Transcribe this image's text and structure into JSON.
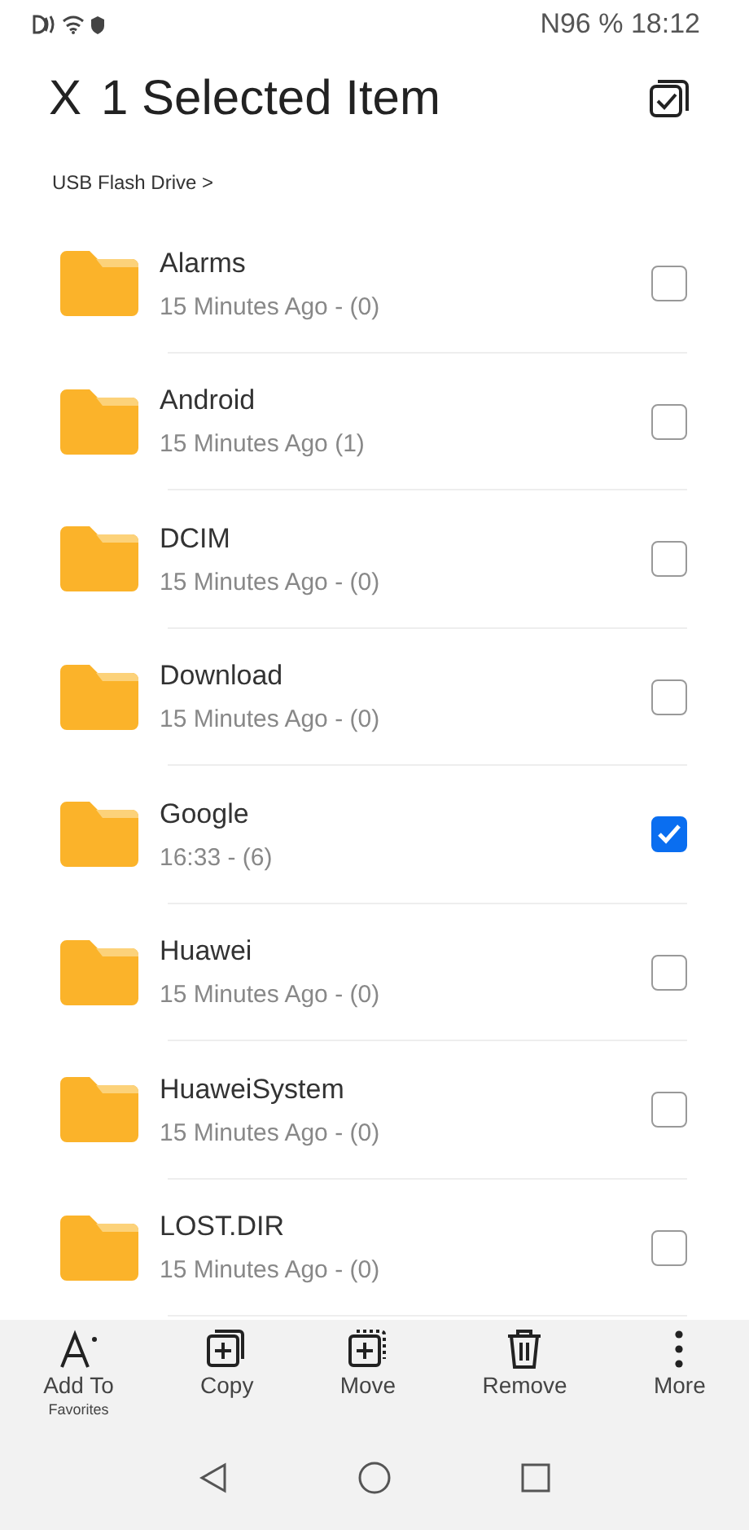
{
  "status_bar": {
    "time": "N96 % 18:12"
  },
  "header": {
    "close": "X",
    "title": "1 Selected Item"
  },
  "breadcrumb": "USB Flash Drive >",
  "folders": [
    {
      "name": "Alarms",
      "info": "15 Minutes Ago - (0)",
      "selected": false
    },
    {
      "name": "Android",
      "info": "15 Minutes Ago (1)",
      "selected": false
    },
    {
      "name": "DCIM",
      "info": "15 Minutes Ago - (0)",
      "selected": false
    },
    {
      "name": "Download",
      "info": "15 Minutes Ago - (0)",
      "selected": false
    },
    {
      "name": "Google",
      "info": "16:33 - (6)",
      "selected": true
    },
    {
      "name": "Huawei",
      "info": "15 Minutes Ago - (0)",
      "selected": false
    },
    {
      "name": "HuaweiSystem",
      "info": "15 Minutes Ago - (0)",
      "selected": false
    },
    {
      "name": "LOST.DIR",
      "info": "15 Minutes Ago - (0)",
      "selected": false
    }
  ],
  "actions": [
    {
      "kind": "favorite",
      "label": "Add To",
      "sublabel": "Favorites"
    },
    {
      "kind": "copy",
      "label": "Copy"
    },
    {
      "kind": "move",
      "label": "Move"
    },
    {
      "kind": "remove",
      "label": "Remove"
    },
    {
      "kind": "more",
      "label": "More"
    }
  ]
}
